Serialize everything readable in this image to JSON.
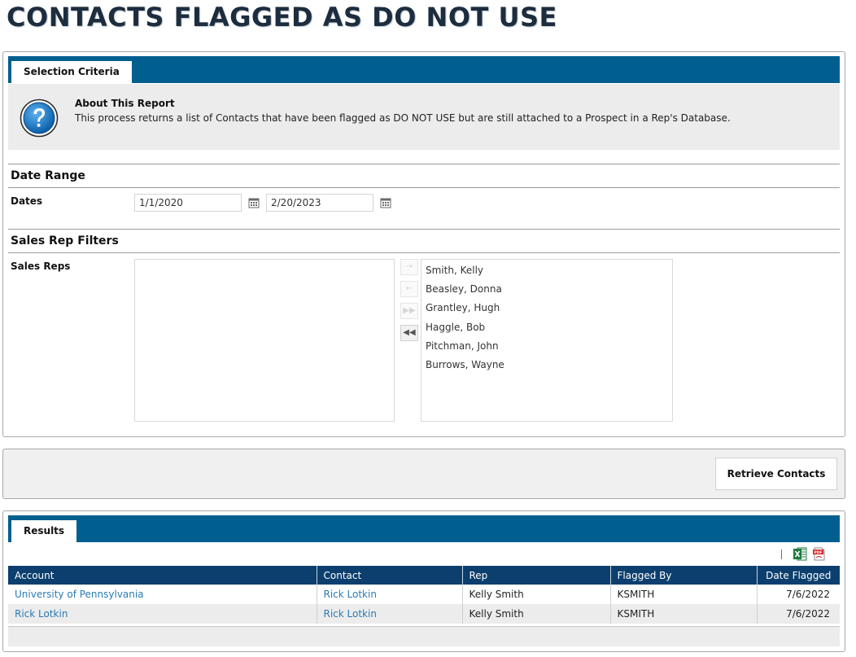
{
  "page": {
    "title": "CONTACTS FLAGGED AS DO NOT USE"
  },
  "selection": {
    "tab_label": "Selection Criteria",
    "about": {
      "title": "About This Report",
      "description": "This process returns a list of Contacts that have been flagged as DO NOT USE but are still attached to a Prospect in a Rep's Database."
    },
    "date_range": {
      "heading": "Date Range",
      "label": "Dates",
      "start": "1/1/2020",
      "end": "2/20/2023"
    },
    "sales_rep_filters": {
      "heading": "Sales Rep Filters",
      "label": "Sales Reps",
      "available": [],
      "selected": [
        "Smith, Kelly",
        "Beasley, Donna",
        "Grantley, Hugh",
        "Haggle, Bob",
        "Pitchman, John",
        "Burrows, Wayne"
      ]
    }
  },
  "actions": {
    "retrieve_label": "Retrieve Contacts"
  },
  "results": {
    "tab_label": "Results",
    "columns": [
      "Account",
      "Contact",
      "Rep",
      "Flagged By",
      "Date Flagged"
    ],
    "rows": [
      {
        "account": "University of Pennsylvania",
        "contact": "Rick Lotkin",
        "rep": "Kelly Smith",
        "flagged_by": "KSMITH",
        "date_flagged": "7/6/2022"
      },
      {
        "account": "Rick Lotkin",
        "contact": "Rick Lotkin",
        "rep": "Kelly Smith",
        "flagged_by": "KSMITH",
        "date_flagged": "7/6/2022"
      }
    ],
    "export_icons": [
      "excel-icon",
      "pdf-icon"
    ]
  },
  "colors": {
    "tab_bar": "#005f8f",
    "table_header": "#0c3f6e",
    "link": "#2a7bb5"
  }
}
